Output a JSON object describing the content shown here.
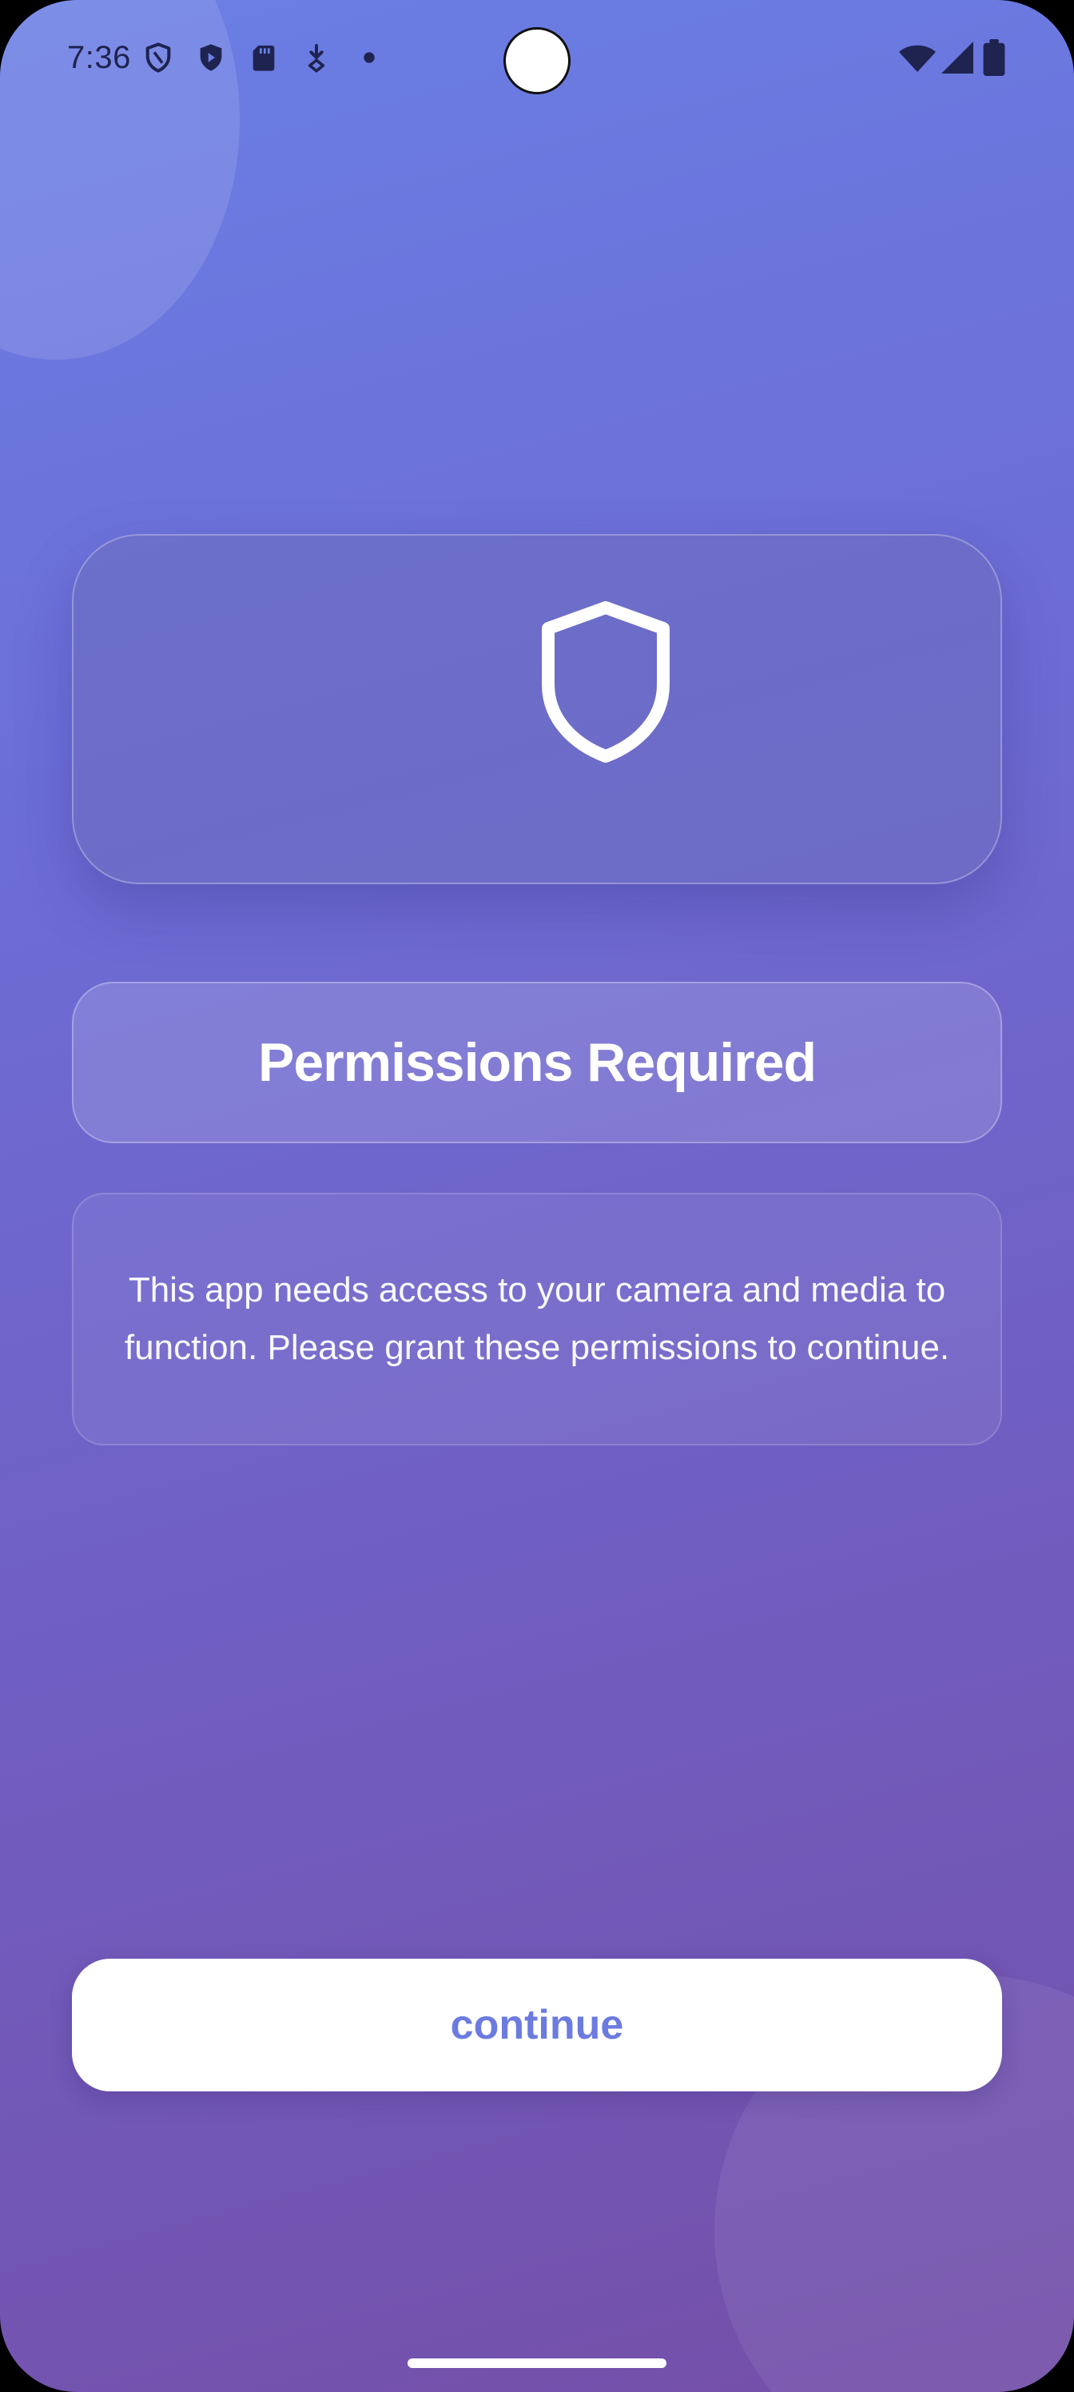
{
  "status_bar": {
    "time": "7:36",
    "icons": [
      "shield-outline-icon",
      "shield-play-icon",
      "sd-card-icon",
      "download-icon",
      "dot-icon",
      "wifi-icon",
      "signal-icon",
      "battery-icon"
    ]
  },
  "main": {
    "icon": "shield-icon",
    "title": "Permissions Required",
    "description": "This app needs access to your camera and media to function. Please grant these permissions to continue.",
    "continue_label": "continue"
  },
  "colors": {
    "gradient_top": "#6a7fe4",
    "gradient_bottom": "#744fa8",
    "button_text": "#6b7be0",
    "status_icons": "#1f2350"
  }
}
